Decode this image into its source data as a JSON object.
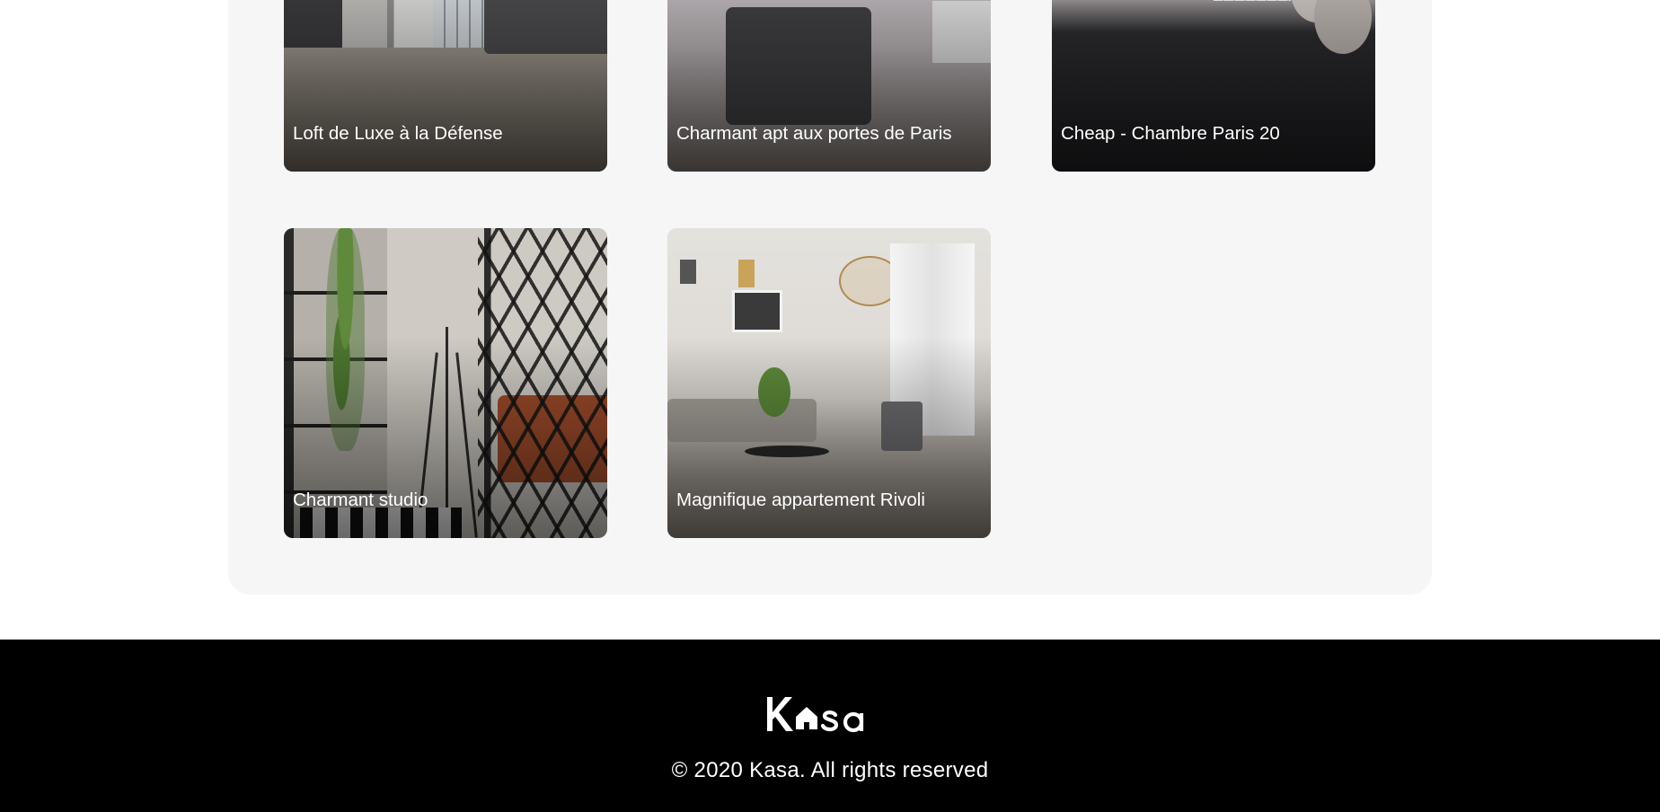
{
  "listings": [
    {
      "title": "Loft de Luxe à la Défense"
    },
    {
      "title": "Charmant apt aux portes de Paris"
    },
    {
      "title": "Cheap - Chambre Paris 20"
    },
    {
      "title": "Charmant studio"
    },
    {
      "title": "Magnifique appartement Rivoli"
    }
  ],
  "footer": {
    "logo_text": "Kasa",
    "copyright": "© 2020 Kasa. All rights reserved"
  },
  "colors": {
    "gallery_background": "#f6f6f6",
    "footer_background": "#000000",
    "footer_text": "#ffffff"
  }
}
